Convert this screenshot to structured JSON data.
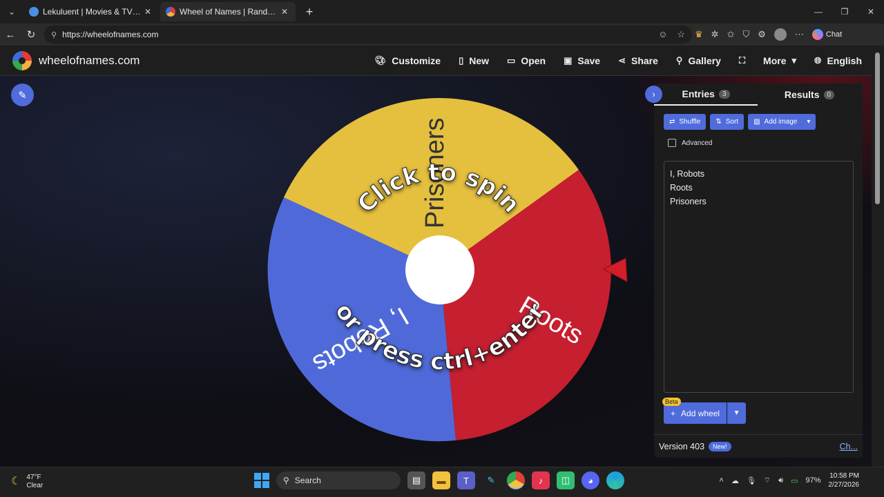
{
  "browser": {
    "tabs": [
      {
        "label": "Lekuluent | Movies & TV Shows",
        "favicon_color": "#4a90e2"
      },
      {
        "label": "Wheel of Names | Random name picker",
        "favicon_color": "#e04040"
      }
    ],
    "url": "https://wheelofnames.com",
    "chat_label": "Chat"
  },
  "app": {
    "brand": "wheelofnames.com",
    "menu": [
      "Customize",
      "New",
      "Open",
      "Save",
      "Share",
      "Gallery",
      "More",
      "English"
    ]
  },
  "wheel": {
    "segments": [
      {
        "label": "Prisoners",
        "color": "#e5c03e"
      },
      {
        "label": "Roots",
        "color": "#c51f30"
      },
      {
        "label": "I, Robots",
        "color": "#4f6ad8"
      }
    ],
    "top_caption": "Click to spin",
    "bottom_caption": "or press ctrl+enter"
  },
  "panel": {
    "entries_tab": "Entries",
    "entries_count": "3",
    "results_tab": "Results",
    "results_count": "0",
    "buttons": {
      "shuffle": "Shuffle",
      "sort": "Sort",
      "add_image": "Add image"
    },
    "advanced_label": "Advanced",
    "entries_list": [
      "I, Robots",
      "Roots",
      "Prisoners"
    ],
    "beta_label": "Beta",
    "add_wheel_label": "Add wheel",
    "version": "Version 403",
    "new_badge": "New!",
    "changelog_link": "Ch..."
  },
  "taskbar": {
    "temperature": "47°F",
    "condition": "Clear",
    "search_label": "Search",
    "battery": "97%",
    "time": "10:58 PM",
    "date": "2/27/2026"
  },
  "colors": {
    "accent": "#4f6bdc",
    "yellow": "#e5c03e",
    "red": "#c51f30",
    "blue": "#4f6ad8"
  }
}
